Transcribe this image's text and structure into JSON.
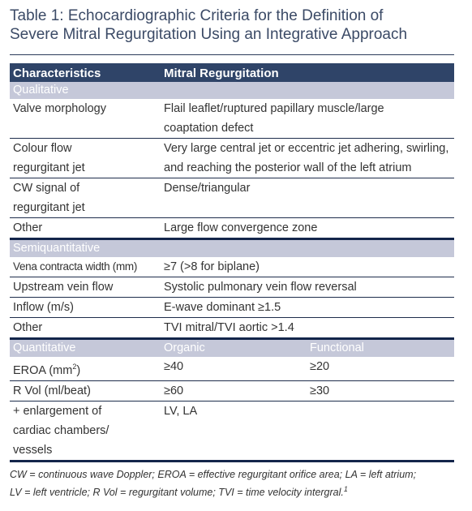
{
  "title": {
    "line1": "Table 1: Echocardiographic Criteria for the Definition of",
    "line2": "Severe Mitral Regurgitation Using an Integrative Approach"
  },
  "table": {
    "headers": [
      "Characteristics",
      "Mitral Regurgitation"
    ],
    "sections": [
      {
        "label": "Qualitative",
        "rows": [
          {
            "characteristic": [
              "Valve morphology"
            ],
            "value": [
              "Flail leaflet/ruptured papillary muscle/large",
              "coaptation defect"
            ]
          },
          {
            "characteristic": [
              "Colour flow",
              "regurgitant jet"
            ],
            "value": [
              "Very large central jet or eccentric jet adhering, swirling,",
              "and reaching the posterior wall of the left atrium"
            ]
          },
          {
            "characteristic": [
              "CW signal of",
              "regurgitant jet"
            ],
            "value": [
              "Dense/triangular"
            ]
          },
          {
            "characteristic": [
              "Other"
            ],
            "value": [
              "Large flow convergence zone"
            ]
          }
        ]
      },
      {
        "label": "Semiquantitative",
        "rows": [
          {
            "characteristic": [
              "Vena contracta width (mm)"
            ],
            "value": [
              "≥7 (>8 for biplane)"
            ]
          },
          {
            "characteristic": [
              "Upstream vein flow"
            ],
            "value": [
              "Systolic pulmonary vein flow reversal"
            ]
          },
          {
            "characteristic": [
              "Inflow (m/s)"
            ],
            "value": [
              "E-wave dominant ≥1.5"
            ]
          },
          {
            "characteristic": [
              "Other"
            ],
            "value": [
              "TVI mitral/TVI aortic >1.4"
            ]
          }
        ]
      },
      {
        "label": "Quantitative",
        "col2": "Organic",
        "col3": "Functional",
        "rows": [
          {
            "characteristic": "EROA (mm",
            "superscript": "2",
            "characteristic_suffix": ")",
            "organic": "≥40",
            "functional": "≥20"
          },
          {
            "characteristic": "R Vol (ml/beat)",
            "organic": "≥60",
            "functional": "≥30"
          },
          {
            "characteristic": [
              "+ enlargement of",
              "cardiac chambers/",
              "vessels"
            ],
            "organic": "LV, LA",
            "functional": ""
          }
        ]
      }
    ]
  },
  "footnote": {
    "line1": "CW = continuous wave Doppler; EROA = effective regurgitant orifice area; LA = left atrium;",
    "line2": "LV = left ventricle; R Vol = regurgitant volume; TVI = time velocity intergral.",
    "ref": "1"
  },
  "colors": {
    "header_bg": "#2f4468",
    "section_bg": "#c5c8d9",
    "title_text": "#3b4a66"
  }
}
